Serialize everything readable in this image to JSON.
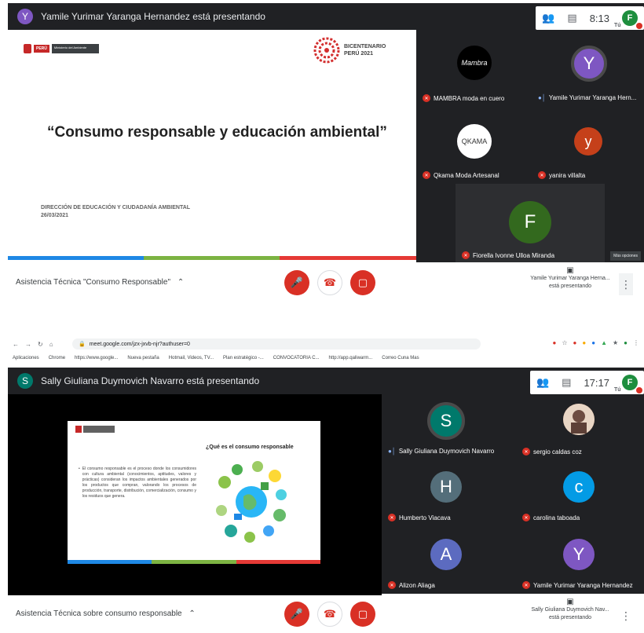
{
  "shot1": {
    "presenter_initial": "Y",
    "presenter_text": "Yamile Yurimar Yaranga Hernandez está presentando",
    "clock": "8:13",
    "you_initial": "F",
    "you_label": "Tú",
    "slide": {
      "ministry_label": "Ministerio del Ambiente",
      "peru_label": "PERÚ",
      "bicentenario_line1": "BICENTENARIO",
      "bicentenario_line2": "PERÚ 2021",
      "title": "“Consumo responsable y educación ambiental”",
      "footer_line1": "DIRECCIÓN DE EDUCACIÓN Y CIUDADANÍA AMBIENTAL",
      "footer_line2": "26/03/2021"
    },
    "participants": [
      {
        "name": "MAMBRA moda en cuero",
        "initial": "Mambra",
        "muted": true,
        "color": "#000000"
      },
      {
        "name": "Yamile Yurimar Yaranga Hern...",
        "initial": "Y",
        "muted": false,
        "color": "#7e57c2"
      },
      {
        "name": "Qkama Moda Artesanal",
        "initial": "QKAMA",
        "muted": true,
        "color": "#ffffff"
      },
      {
        "name": "yanira villalta",
        "initial": "y",
        "muted": true,
        "color": "#c5401a"
      },
      {
        "name": "Fiorella Ivonne Ulloa Miranda",
        "initial": "F",
        "muted": true,
        "color": "#33691e"
      }
    ],
    "more_options": "Más opciones",
    "meeting_title": "Asistencia Técnica \"Consumo Responsable\"",
    "presenting_line1": "Yamile Yurimar Yaranga Herna...",
    "presenting_line2": "está presentando"
  },
  "shot2": {
    "url": "meet.google.com/jzx-jxvb-njr?authuser=0",
    "bookmarks": [
      "Aplicaciones",
      "Chrome",
      "https://www.google...",
      "Nueva pestaña",
      "Hotmail, Videos, TV...",
      "Plan estratégico -...",
      "CONVOCATORIA C...",
      "http://app.qaliwarm...",
      "Correo Cuna Mas"
    ],
    "presenter_initial": "S",
    "presenter_text": "Sally Giuliana Duymovich Navarro está presentando",
    "clock": "17:17",
    "you_initial": "F",
    "you_label": "Tú",
    "slide": {
      "heading": "¿Qué es el consumo responsable",
      "bullet": "El consumo responsable es el proceso donde los consumidores con cultura ambiental (conocimientos, aptitudes, valores y prácticas) consideran los impactos ambientales generados por los productos que compran, valorando los procesos de producción, transporte, distribución, comercialización, consumo y los residuos que genera."
    },
    "participants": [
      {
        "name": "Sally Giuliana Duymovich Navarro",
        "initial": "S",
        "muted": false,
        "color": "#00796b"
      },
      {
        "name": "sergio caldas coz",
        "initial": "",
        "muted": true,
        "color": "#a0522d"
      },
      {
        "name": "Humberto Viacava",
        "initial": "H",
        "muted": true,
        "color": "#546e7a"
      },
      {
        "name": "carolina taboada",
        "initial": "c",
        "muted": true,
        "color": "#039be5"
      },
      {
        "name": "Alizon Aliaga",
        "initial": "A",
        "muted": true,
        "color": "#5c6bc0"
      },
      {
        "name": "Yamile Yurimar Yaranga Hernandez",
        "initial": "Y",
        "muted": true,
        "color": "#7e57c2"
      }
    ],
    "meeting_title": "Asistencia Técnica sobre consumo responsable",
    "presenting_line1": "Sally Giuliana Duymovich Nav...",
    "presenting_line2": "está presentando"
  },
  "colors": {
    "meet_dark": "#202124",
    "red": "#d93025",
    "stripe_blue": "#1e88e5",
    "stripe_green": "#7cb342",
    "stripe_red": "#e53935"
  }
}
